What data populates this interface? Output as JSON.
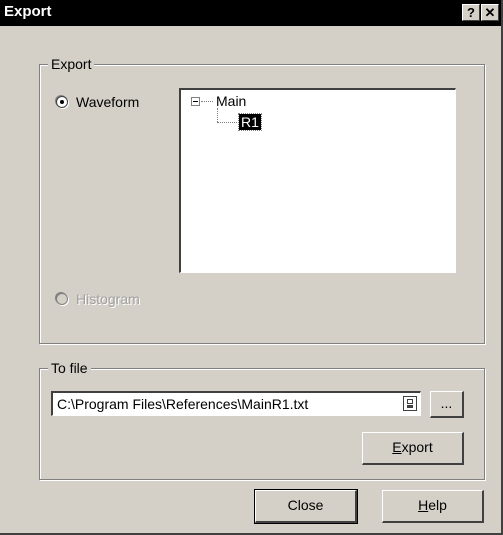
{
  "window": {
    "title": "Export",
    "help_btn": "?",
    "close_btn": "✕"
  },
  "export_group": {
    "label": "Export",
    "waveform_label": "Waveform",
    "histogram_label": "Histogram",
    "selected": "Waveform",
    "tree": {
      "root": "Main",
      "child": "R1"
    }
  },
  "file_group": {
    "label": "To file",
    "path_value": "C:\\Program Files\\References\\MainR1.txt",
    "browse_label": "...",
    "export_label_first": "E",
    "export_label_rest": "xport"
  },
  "footer": {
    "close_label": "Close",
    "help_label_first": "H",
    "help_label_rest": "elp"
  }
}
